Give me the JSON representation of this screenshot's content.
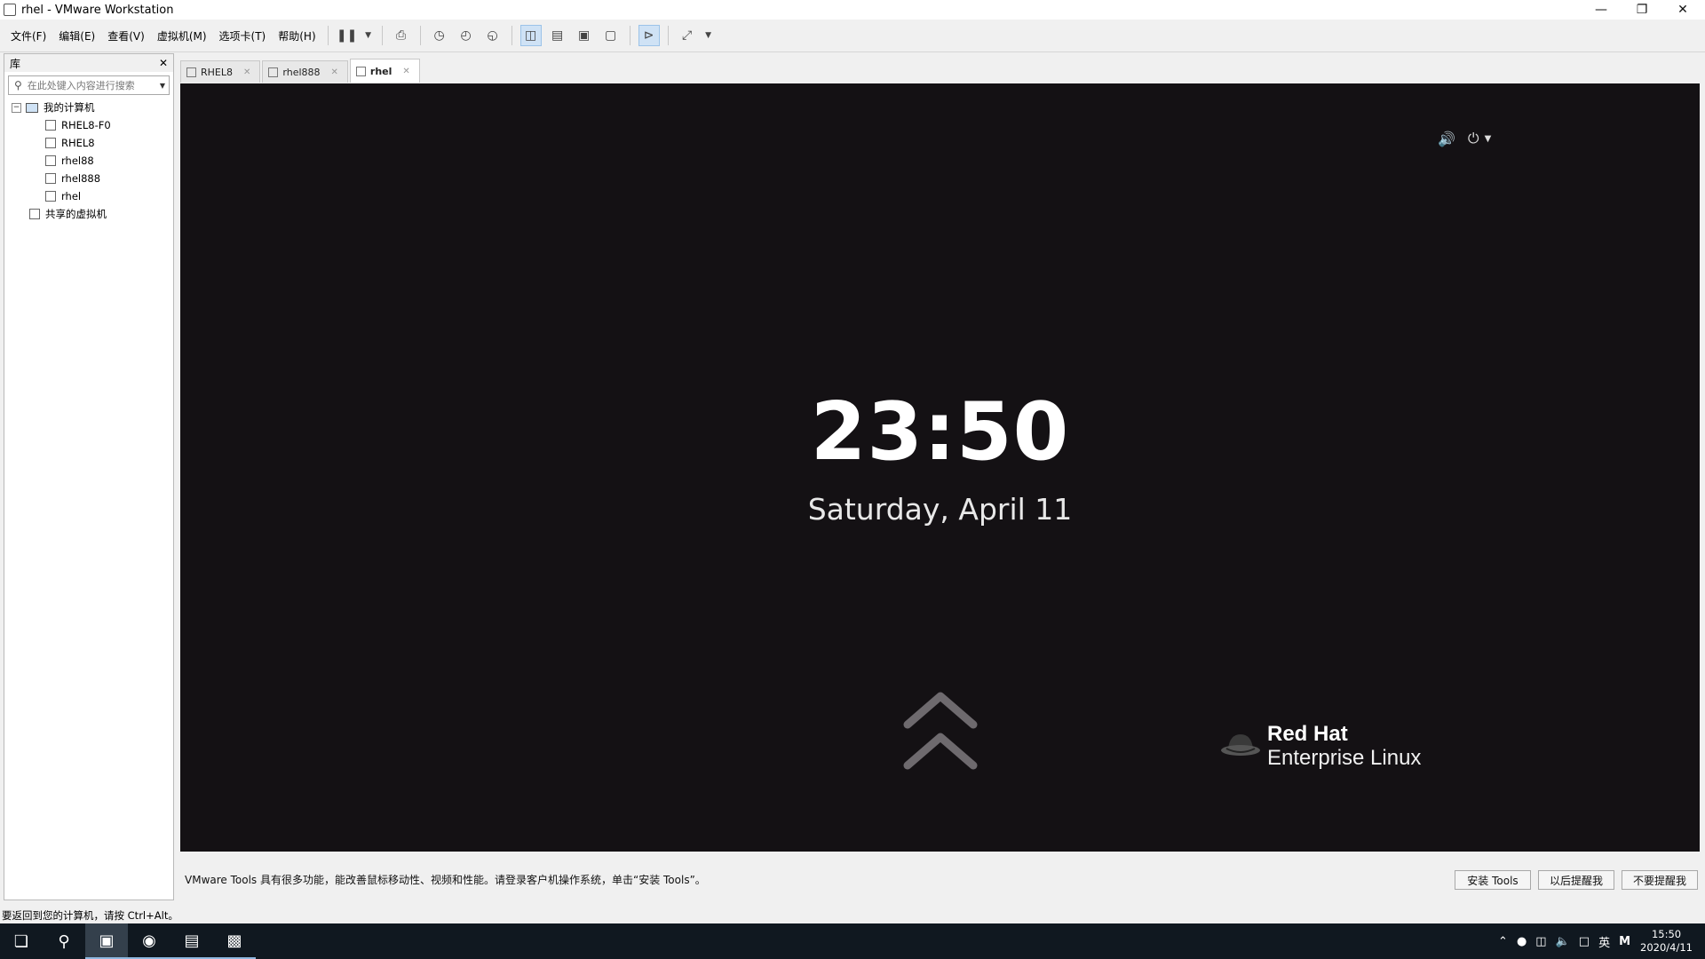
{
  "window": {
    "title": "rhel - VMware Workstation",
    "minimize_icon": "minimize-icon",
    "restore_icon": "restore-icon",
    "close_icon": "close-icon"
  },
  "menu": {
    "items": [
      "文件(F)",
      "编辑(E)",
      "查看(V)",
      "虚拟机(M)",
      "选项卡(T)",
      "帮助(H)"
    ]
  },
  "library": {
    "title": "库",
    "search_placeholder": "在此处键入内容进行搜索",
    "root_label": "我的计算机",
    "vms": [
      "RHEL8-F0",
      "RHEL8",
      "rhel88",
      "rhel888",
      "rhel"
    ],
    "shared_label": "共享的虚拟机"
  },
  "tabs": [
    {
      "label": "RHEL8",
      "active": false
    },
    {
      "label": "rhel888",
      "active": false
    },
    {
      "label": "rhel",
      "active": true
    }
  ],
  "vm_screen": {
    "time": "23:50",
    "date": "Saturday, April 11",
    "brand": "Red Hat",
    "product": "Enterprise Linux",
    "background_color": "#141114"
  },
  "notification": {
    "message": "VMware Tools 具有很多功能，能改善鼠标移动性、视频和性能。请登录客户机操作系统，单击“安装 Tools”。",
    "install_label": "安装 Tools",
    "remind_later_label": "以后提醒我",
    "never_remind_label": "不要提醒我"
  },
  "status": {
    "text": "要返回到您的计算机，请按 Ctrl+Alt。"
  },
  "taskbar": {
    "tray_ime": "英",
    "tray_m": "M",
    "time": "15:50",
    "date": "2020/4/11"
  }
}
